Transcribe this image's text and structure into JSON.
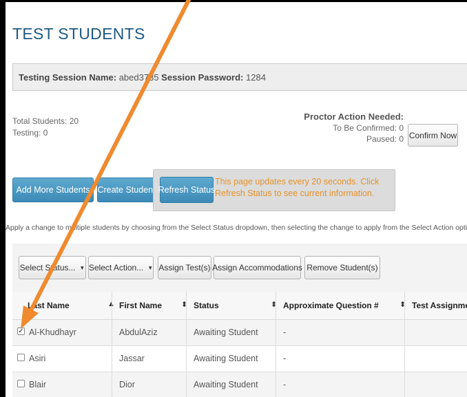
{
  "page": {
    "title": "TEST STUDENTS"
  },
  "session": {
    "name_label": "Testing Session Name:",
    "name_value": "abed3735",
    "password_label": "Session Password:",
    "password_value": "1284"
  },
  "stats": {
    "total": "Total Students: 20",
    "testing": "Testing: 0"
  },
  "proctor": {
    "heading": "Proctor Action Needed:",
    "to_confirm": "To Be Confirmed: 0",
    "paused": "Paused: 0",
    "confirm_button": "Confirm Now"
  },
  "actions": {
    "add_more": "Add More Students",
    "create": "Create Student",
    "refresh": "Refresh Status",
    "refresh_note": "This page updates every 20 seconds. Click Refresh Status to see current information."
  },
  "help_text": "Apply a change to multiple students by choosing from the Select Status dropdown, then selecting the change to apply from the Select Action options.",
  "toolbar": {
    "select_status": "Select Status...",
    "select_action": "Select Action...",
    "assign_tests": "Assign Test(s)",
    "assign_accommodations": "Assign Accommodations",
    "remove_students": "Remove Student(s)"
  },
  "table": {
    "columns": [
      "Last Name",
      "First Name",
      "Status",
      "Approximate Question #",
      "Test Assignment"
    ],
    "rows": [
      {
        "checked": true,
        "last": "Al-Khudhayr",
        "first": "AbdulAziz",
        "status": "Awaiting Student",
        "question": "-",
        "assignment": ""
      },
      {
        "checked": false,
        "last": "Asiri",
        "first": "Jassar",
        "status": "Awaiting Student",
        "question": "-",
        "assignment": ""
      },
      {
        "checked": false,
        "last": "Blair",
        "first": "Dior",
        "status": "Awaiting Student",
        "question": "-",
        "assignment": ""
      }
    ]
  },
  "colors": {
    "title": "#1e5a82",
    "primary_button": "#3c8ab6",
    "note_text": "#e5922a",
    "annotation_arrow": "#f08a2e"
  },
  "icons": {
    "sort_ascending": "caret-up-icon",
    "sort_both": "sort-icon",
    "dropdown": "caret-down-icon",
    "checkbox": "checkbox-icon",
    "annotation": "arrow-annotation-icon"
  }
}
